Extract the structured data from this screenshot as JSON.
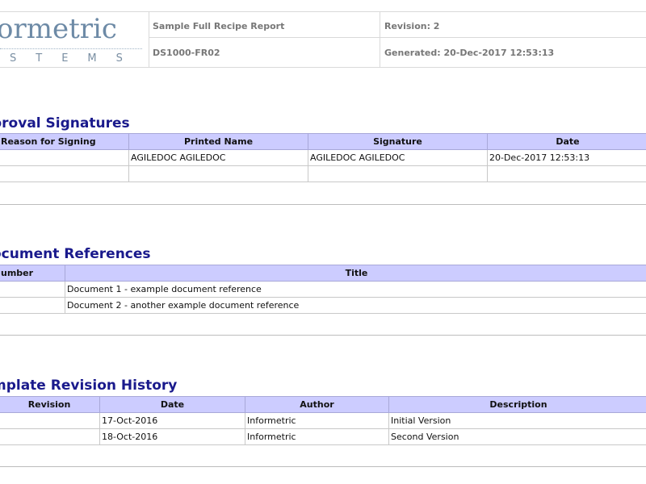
{
  "header": {
    "logo_main": "ormetric",
    "logo_sub": "STEMS",
    "report_title": "Sample Full Recipe Report",
    "doc_id": "DS1000-FR02",
    "revision": "Revision: 2",
    "generated": "Generated: 20-Dec-2017 12:53:13"
  },
  "approval": {
    "title": "proval Signatures",
    "headers": [
      "Reason for Signing",
      "Printed Name",
      "Signature",
      "Date"
    ],
    "rows": [
      [
        "",
        "AGILEDOC AGILEDOC",
        "AGILEDOC AGILEDOC",
        "20-Dec-2017 12:53:13"
      ],
      [
        "",
        "",
        "",
        ""
      ]
    ]
  },
  "references": {
    "title": "ocument References",
    "headers": [
      "umber",
      "Title"
    ],
    "rows": [
      [
        "",
        "Document 1 - example document reference"
      ],
      [
        "",
        "Document 2 - another example document reference"
      ]
    ]
  },
  "history": {
    "title": "mplate Revision History",
    "headers": [
      "Revision",
      "Date",
      "Author",
      "Description"
    ],
    "rows": [
      [
        "",
        "17-Oct-2016",
        "Informetric",
        "Initial Version"
      ],
      [
        "",
        "18-Oct-2016",
        "Informetric",
        "Second Version"
      ]
    ]
  }
}
